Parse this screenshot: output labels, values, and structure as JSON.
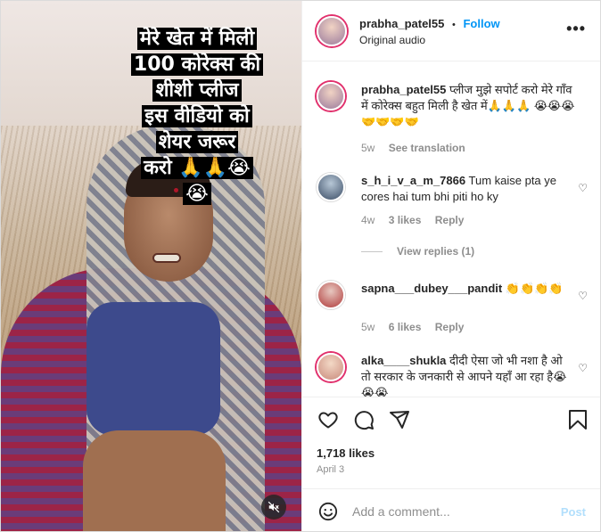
{
  "media": {
    "caption_lines": [
      "मेरे खेत में मिली",
      "100 कोरेक्स की",
      "शीशी प्लीज",
      "इस वीडियो को",
      "शेयर जरूर",
      "करो 🙏🙏😭",
      "😭"
    ]
  },
  "header": {
    "username": "prabha_patel55",
    "separator": "•",
    "follow_label": "Follow",
    "subtitle": "Original audio",
    "more_glyph": "•••"
  },
  "comments": [
    {
      "username": "prabha_patel55",
      "text": "प्लीज मुझे सपोर्ट करो मेरे गाँव में कोरेक्स बहुत मिली है खेत में🙏🙏🙏 😭😭😭🤝🤝🤝🤝",
      "time": "5w",
      "action": "See translation"
    },
    {
      "username": "s_h_i_v_a_m_7866",
      "text": "Tum kaise pta ye cores hai tum bhi piti ho ky",
      "time": "4w",
      "likes": "3 likes",
      "reply": "Reply"
    },
    {
      "username": "sapna___dubey___pandit",
      "text": "👏👏👏👏",
      "time": "5w",
      "likes": "6 likes",
      "reply": "Reply"
    },
    {
      "username": "alka____shukla",
      "text": "दीदी ऐसा जो भी नशा है ओ तो सरकार के जनकारी से आपने यहाँ आ रहा है😭😭😭",
      "time": "",
      "likes": "",
      "reply": ""
    }
  ],
  "view_replies": "View replies (1)",
  "actions": {
    "likes": "1,718 likes",
    "date": "April 3"
  },
  "add_comment": {
    "placeholder": "Add a comment...",
    "post_label": "Post"
  },
  "colors": {
    "accent": "#0095f6",
    "post_disabled": "#b2dffc",
    "muted": "#8e8e8e"
  }
}
